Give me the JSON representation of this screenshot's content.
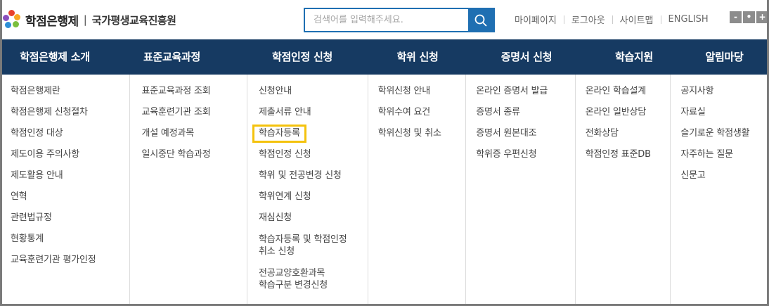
{
  "header": {
    "site_title": "학점은행제",
    "separator": "|",
    "org_name": "국가평생교육진흥원",
    "search_placeholder": "검색어를 입력해주세요.",
    "util_links": [
      "마이페이지",
      "로그아웃",
      "사이트맵",
      "ENGLISH"
    ],
    "zoom": {
      "out": "-",
      "reset": "•",
      "in": "+"
    }
  },
  "nav": {
    "items": [
      "학점은행제 소개",
      "표준교육과정",
      "학점인정 신청",
      "학위 신청",
      "증명서 신청",
      "학습지원",
      "알림마당"
    ]
  },
  "menu": {
    "columns": [
      [
        "학점은행제란",
        "학점은행제 신청절차",
        "학점인정 대상",
        "제도이용 주의사항",
        "제도활용 안내",
        "연혁",
        "관련법규정",
        "현황통계",
        "교육훈련기관 평가인정"
      ],
      [
        "표준교육과정 조회",
        "교육훈련기관 조회",
        "개설 예정과목",
        "일시중단 학습과정"
      ],
      [
        "신청안내",
        "제출서류 안내",
        "학습자등록",
        "학점인정 신청",
        "학위 및 전공변경 신청",
        "학위연계 신청",
        "재심신청",
        "학습자등록 및 학점인정\n취소 신청",
        "전공교양호환과목\n학습구분 변경신청"
      ],
      [
        "학위신청 안내",
        "학위수여 요건",
        "학위신청 및 취소"
      ],
      [
        "온라인 증명서 발급",
        "증명서 종류",
        "증명서 원본대조",
        "학위증 우편신청"
      ],
      [
        "온라인 학습설계",
        "온라인 일반상담",
        "전화상담",
        "학점인정 표준DB"
      ],
      [
        "공지사항",
        "자료실",
        "슬기로운 학점생활",
        "자주하는 질문",
        "신문고"
      ]
    ],
    "highlighted": "학습자등록"
  },
  "colors": {
    "nav_bg": "#163a62",
    "search_border": "#1f6fb2",
    "highlight": "#f4c20d"
  }
}
